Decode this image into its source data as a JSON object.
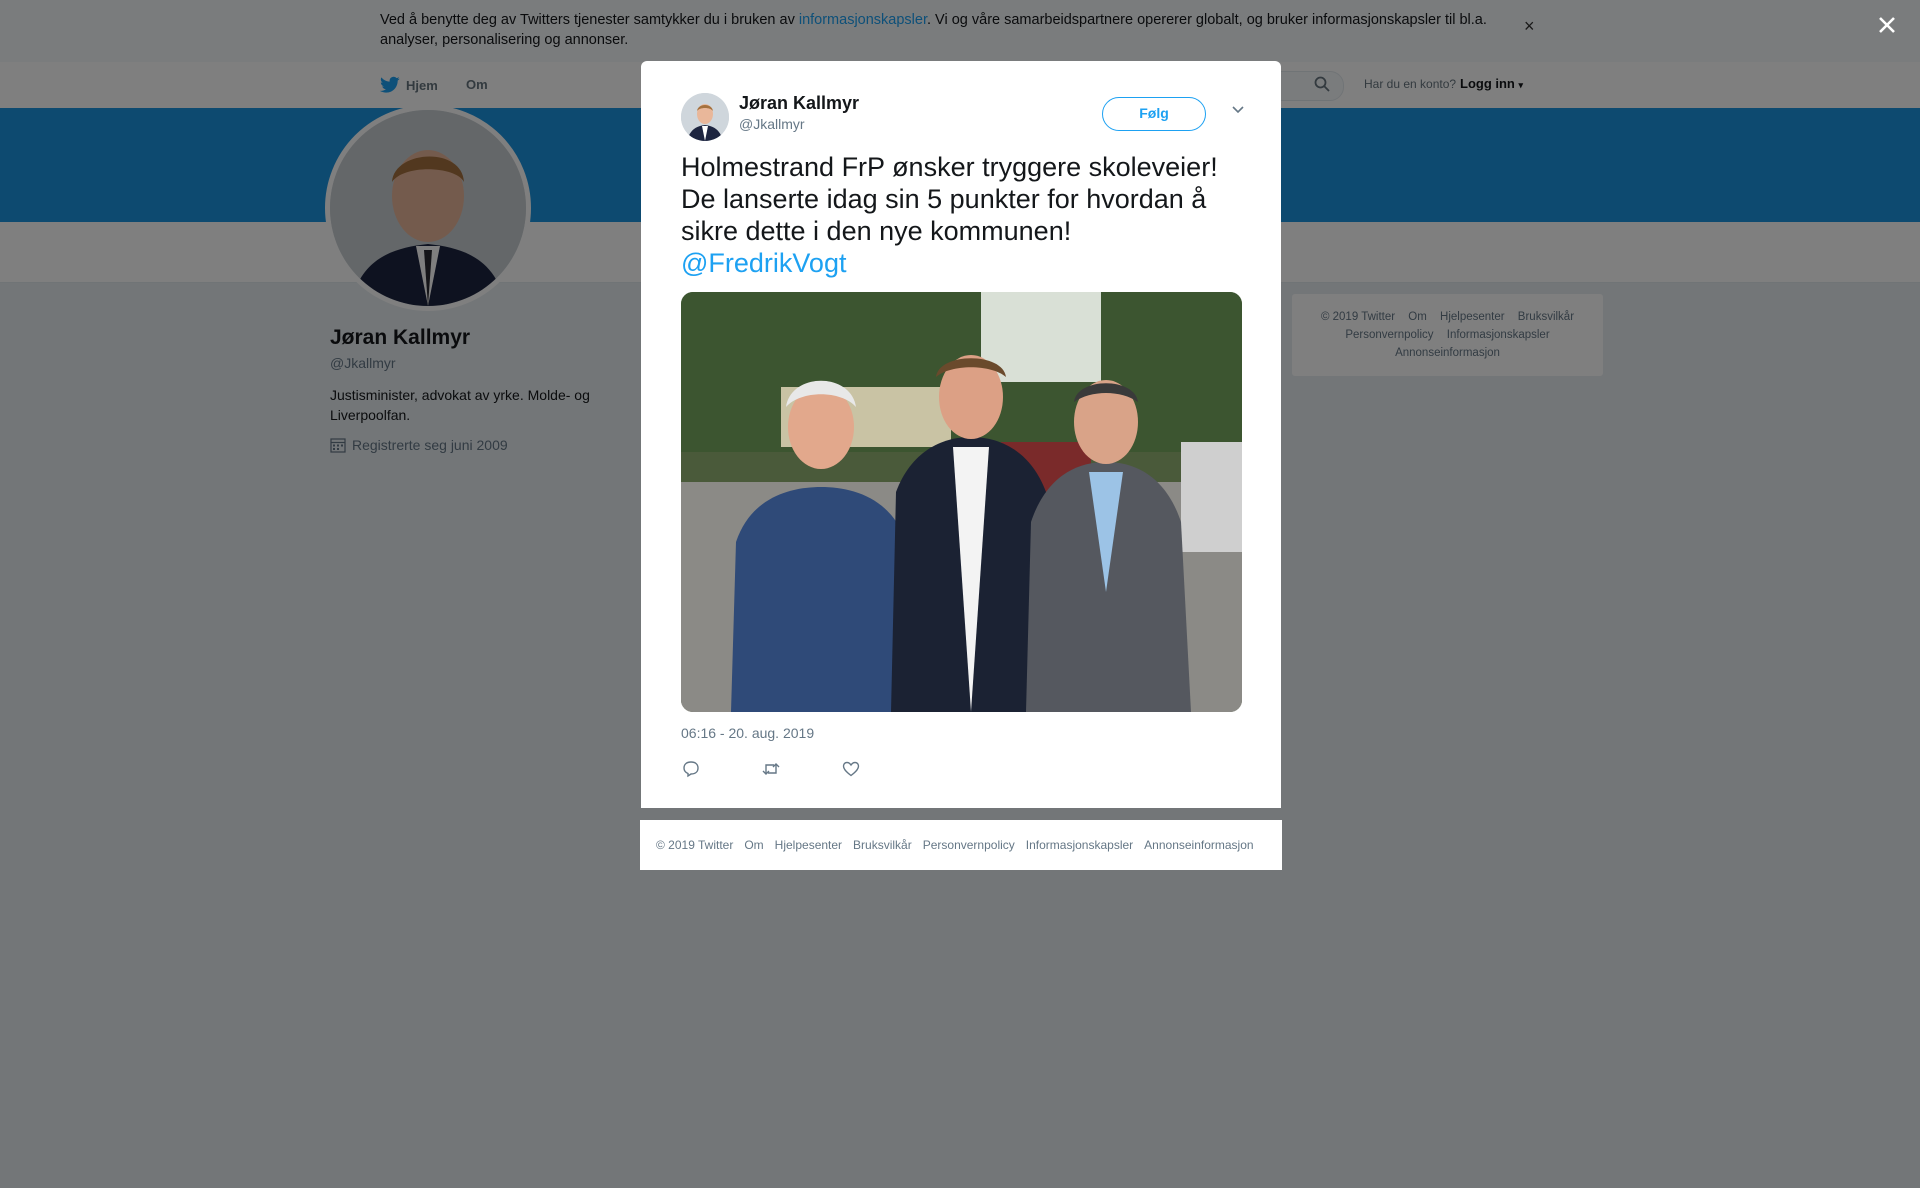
{
  "cookie_banner": {
    "text_before": "Ved å benytte deg av Twitters tjenester samtykker du i bruken av ",
    "link": "informasjonskapsler",
    "text_after": ". Vi og våre samarbeidspartnere opererer globalt, og bruker informasjonskapsler til bl.a. analyser, personalisering og annonser.",
    "close": "×"
  },
  "nav": {
    "home": "Hjem",
    "about": "Om",
    "login_question": "Har du en konto?",
    "login": "Logg inn"
  },
  "profile": {
    "name": "Jøran Kallmyr",
    "handle": "@Jkallmyr",
    "bio": "Justisminister, advokat av yrke. Molde- og Liverpoolfan.",
    "joined": "Registrerte seg juni 2009"
  },
  "side_footer": [
    "© 2019 Twitter",
    "Om",
    "Hjelpesenter",
    "Bruksvilkår",
    "Personvernpolicy",
    "Informasjonskapsler",
    "Annonseinformasjon"
  ],
  "tweet": {
    "name": "Jøran Kallmyr",
    "handle": "@Jkallmyr",
    "follow": "Følg",
    "text": "Holmestrand FrP ønsker tryggere skoleveier! De lanserte idag sin 5 punkter for hvordan å sikre dette i den nye kommunen!",
    "mention": "@FredrikVogt",
    "timestamp": "06:16 - 20. aug. 2019"
  },
  "modal_footer": [
    "© 2019 Twitter",
    "Om",
    "Hjelpesenter",
    "Bruksvilkår",
    "Personvernpolicy",
    "Informasjonskapsler",
    "Annonseinformasjon"
  ],
  "colors": {
    "accent": "#1da1f2",
    "banner": "#1b95e0",
    "overlay": "rgba(0,0,0,0.5)"
  },
  "icons": [
    "twitter-bird-icon",
    "search-icon",
    "calendar-icon",
    "close-icon",
    "chevron-down-icon",
    "reply-icon",
    "retweet-icon",
    "like-icon"
  ]
}
